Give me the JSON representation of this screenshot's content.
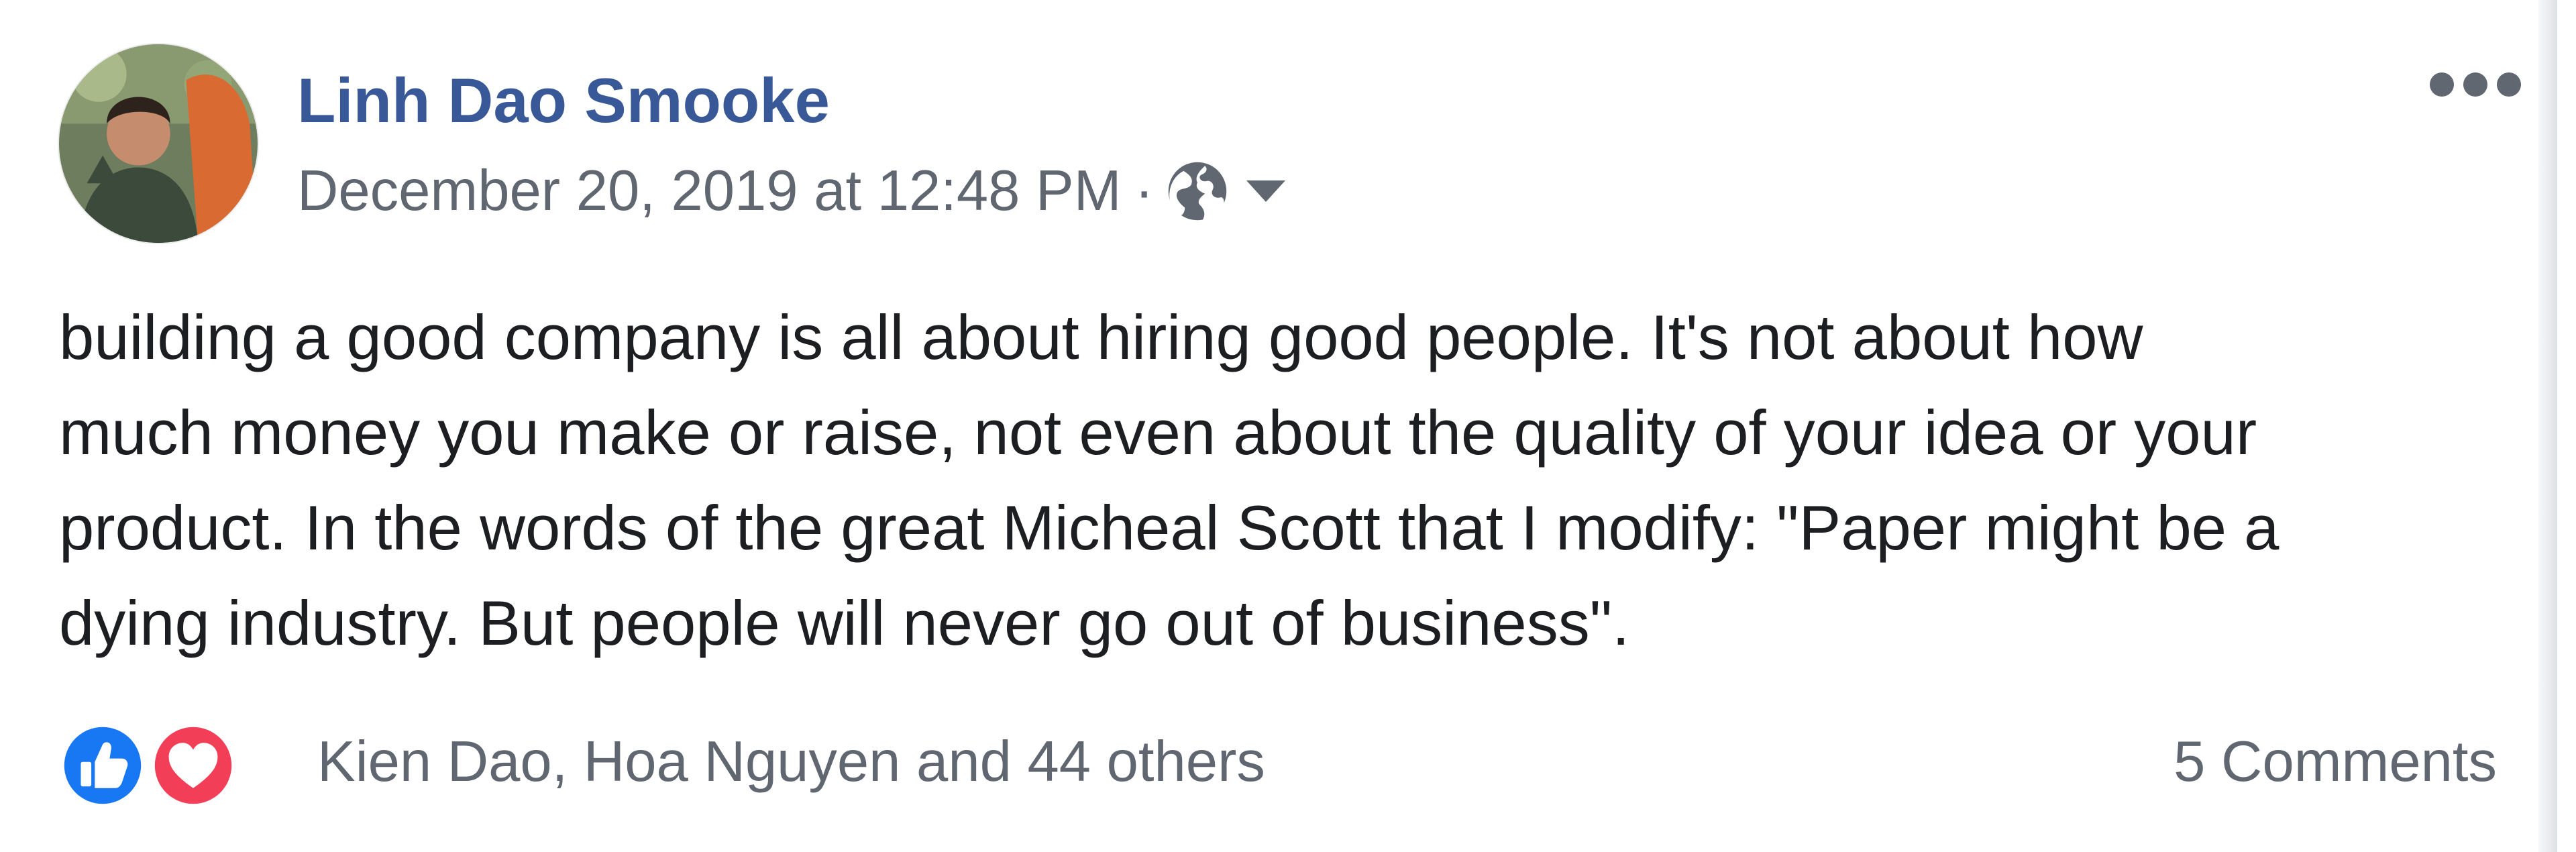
{
  "post": {
    "author": {
      "name": "Linh Dao Smooke",
      "avatar_icon": "profile-photo"
    },
    "timestamp": "December 20, 2019 at 12:48 PM",
    "separator": "·",
    "audience_icon": "globe-icon",
    "audience_menu_icon": "caret-down-icon",
    "more_icon": "ellipsis-icon",
    "text_lines": [
      "building a good company is all about hiring good people. It's not about how",
      "much money you make or raise, not even about the quality of your idea or your",
      "product. In the words of the great Micheal Scott that I modify: \"Paper might be a",
      "dying industry. But people will never go out of business\"."
    ]
  },
  "reactions": {
    "icons": [
      "like-icon",
      "love-icon"
    ],
    "names": "Kien Dao, Hoa Nguyen and 44 others",
    "comments": "5 Comments"
  },
  "colors": {
    "author_link": "#385898",
    "meta_text": "#606770",
    "body_text": "#1c1e21",
    "like_blue": "#1877f2",
    "love_red": "#f33e58"
  }
}
